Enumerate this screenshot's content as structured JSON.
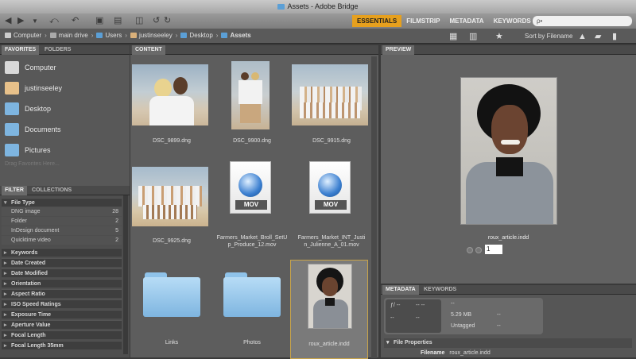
{
  "window": {
    "title": "Assets - Adobe Bridge"
  },
  "toolbar": {
    "workspaces": [
      "ESSENTIALS",
      "FILMSTRIP",
      "METADATA",
      "KEYWORDS"
    ],
    "active_workspace": "ESSENTIALS",
    "search_placeholder": "ρ•"
  },
  "path": {
    "crumbs": [
      "Computer",
      "main drive",
      "Users",
      "justinseeley",
      "Desktop",
      "Assets"
    ],
    "sort_label": "Sort by Filename"
  },
  "favorites": {
    "tabs": [
      "FAVORITES",
      "FOLDERS"
    ],
    "items": [
      "Computer",
      "justinseeley",
      "Desktop",
      "Documents",
      "Pictures"
    ],
    "hint": "Drag Favorites Here..."
  },
  "filter": {
    "tabs": [
      "FILTER",
      "COLLECTIONS"
    ],
    "file_type": "File Type",
    "values": [
      {
        "label": "DNG image",
        "count": "28"
      },
      {
        "label": "Folder",
        "count": "2"
      },
      {
        "label": "InDesign document",
        "count": "5"
      },
      {
        "label": "Quicktime video",
        "count": "2"
      }
    ],
    "categories": [
      "Keywords",
      "Date Created",
      "Date Modified",
      "Orientation",
      "Aspect Ratio",
      "ISO Speed Ratings",
      "Exposure Time",
      "Aperture Value",
      "Focal Length",
      "Focal Length 35mm"
    ]
  },
  "content": {
    "tab": "CONTENT",
    "items": [
      {
        "label": "DSC_9899.dng"
      },
      {
        "label": "DSC_9900.dng"
      },
      {
        "label": "DSC_9915.dng"
      },
      {
        "label": "DSC_9925.dng"
      },
      {
        "label": "Farmers_Market_Broll_SetU p_Produce_12.mov"
      },
      {
        "label": "Farmers_Market_INT_Justi n_Julienne_A_01.mov"
      },
      {
        "label": "Links"
      },
      {
        "label": "Photos"
      },
      {
        "label": "roux_article.indd"
      }
    ],
    "mov_badge": "MOV"
  },
  "preview": {
    "tab": "PREVIEW",
    "filename": "roux_article.indd",
    "page": "1"
  },
  "metadata": {
    "tabs": [
      "METADATA",
      "KEYWORDS"
    ],
    "cam_fnumber": "ƒ/ --",
    "cam_shutter": "-- --",
    "cam_dash1": "--",
    "cam_dash2": "--",
    "line1": "--",
    "size": "5.29 MB",
    "size_dash": "--",
    "tag": "Untagged",
    "tag_dash": "--",
    "section": "File Properties",
    "row_label": "Filename",
    "row_value": "roux_article.indd"
  },
  "colors": {
    "accent": "#e6a01e",
    "folder": "#7eb5e0",
    "selection": "#c9a44a"
  }
}
